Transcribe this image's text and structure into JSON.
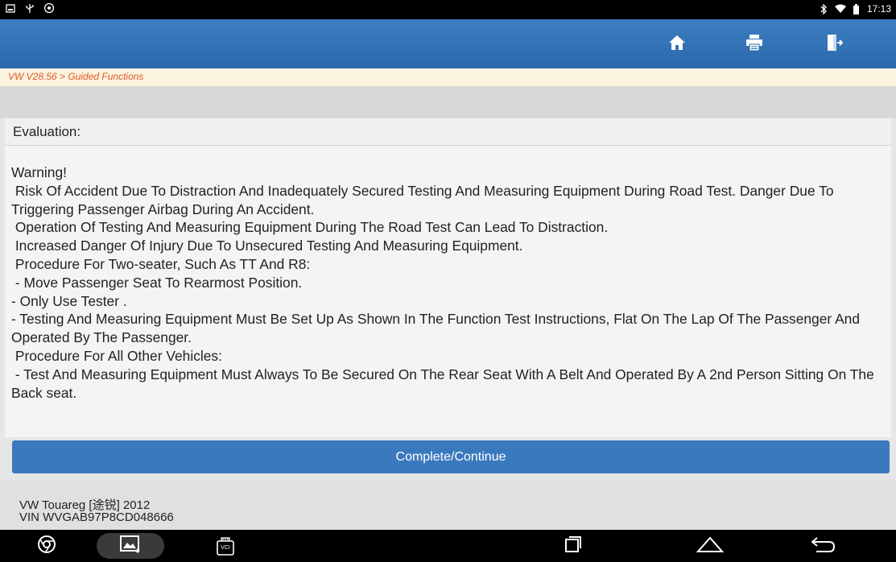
{
  "status_bar": {
    "time": "17:13",
    "left_icons": [
      "screenshot-icon",
      "usb-icon",
      "settings-circle-icon"
    ],
    "right_icons": [
      "bluetooth-icon",
      "wifi-icon",
      "battery-icon"
    ]
  },
  "header": {
    "buttons": [
      "home-icon",
      "print-icon",
      "exit-icon"
    ]
  },
  "breadcrumb": "VW V28.56 > Guided Functions",
  "evaluation_label": "Evaluation:",
  "warning_text": "Warning!\n Risk Of Accident Due To Distraction And Inadequately Secured Testing And Measuring Equipment During Road Test. Danger Due To Triggering Passenger Airbag During An Accident.\n Operation Of Testing And Measuring Equipment During The Road Test Can Lead To Distraction.\n Increased Danger Of Injury Due To Unsecured Testing And Measuring Equipment.\n Procedure For Two-seater, Such As TT And R8:\n - Move Passenger Seat To Rearmost Position.\n- Only Use Tester .\n- Testing And Measuring Equipment Must Be Set Up As Shown In The Function Test Instructions, Flat On The Lap Of The Passenger And Operated By The Passenger.\n Procedure For All Other Vehicles:\n - Test And Measuring Equipment Must Always To Be Secured On The Rear Seat With A Belt And Operated By A 2nd Person Sitting On The Back seat.",
  "continue_label": "Complete/Continue",
  "footer": {
    "vehicle": "VW Touareg [途锐] 2012",
    "vin": "VIN WVGAB97P8CD048666"
  },
  "nav_bar": {
    "vci_label": "VCI",
    "icons": [
      "chrome-icon",
      "gallery-icon",
      "vci-icon",
      "recents-icon",
      "home-outline-icon",
      "back-icon"
    ]
  },
  "colors": {
    "header": "#2f6fb1",
    "button": "#3a79be",
    "breadcrumb_text": "#e05a2b"
  }
}
